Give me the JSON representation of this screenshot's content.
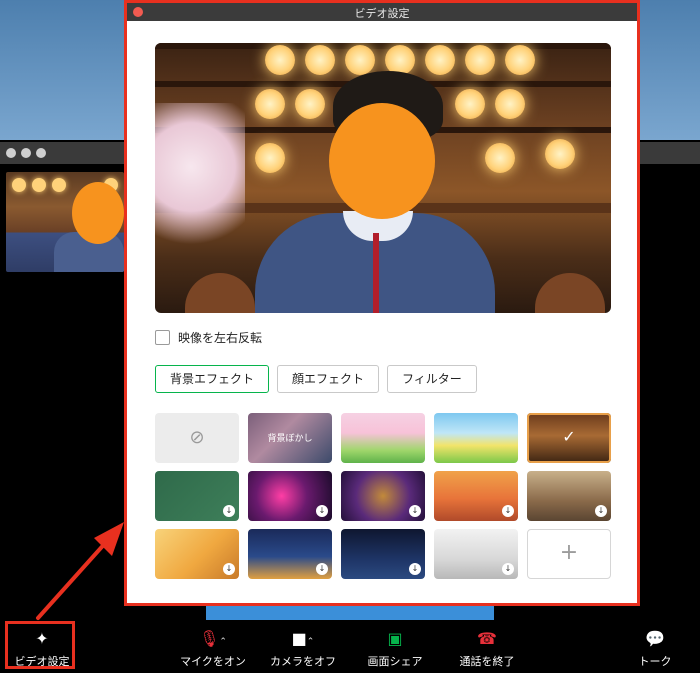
{
  "dialog": {
    "title": "ビデオ設定",
    "mirror_label": "映像を左右反転",
    "mirror_checked": false,
    "tabs": [
      {
        "label": "背景エフェクト",
        "active": true
      },
      {
        "label": "顔エフェクト",
        "active": false
      },
      {
        "label": "フィルター",
        "active": false
      }
    ],
    "effects": [
      {
        "type": "none",
        "icon": "none-icon"
      },
      {
        "type": "blur",
        "label": "背景ぼかし"
      },
      {
        "type": "bg",
        "theme": "spring-flowers"
      },
      {
        "type": "bg",
        "theme": "meadow"
      },
      {
        "type": "bg",
        "theme": "izakaya",
        "selected": true
      },
      {
        "type": "bg",
        "theme": "chalkboard",
        "download": true
      },
      {
        "type": "bg",
        "theme": "neon-glasses",
        "download": true
      },
      {
        "type": "bg",
        "theme": "party-characters",
        "download": true
      },
      {
        "type": "bg",
        "theme": "orange-room",
        "download": true
      },
      {
        "type": "bg",
        "theme": "classroom",
        "download": true
      },
      {
        "type": "bg",
        "theme": "sunny-room",
        "download": true
      },
      {
        "type": "bg",
        "theme": "night-city",
        "download": true
      },
      {
        "type": "bg",
        "theme": "starry-sky",
        "download": true
      },
      {
        "type": "bg",
        "theme": "white-office",
        "download": true
      },
      {
        "type": "add",
        "icon": "plus-icon"
      }
    ]
  },
  "toolbar": {
    "items": [
      {
        "label": "ビデオ設定",
        "icon": "sparkle-icon"
      },
      {
        "label": "マイクをオン",
        "icon": "mic-off-icon"
      },
      {
        "label": "カメラをオフ",
        "icon": "camera-icon"
      },
      {
        "label": "画面シェア",
        "icon": "screen-share-icon"
      },
      {
        "label": "通話を終了",
        "icon": "hang-up-icon"
      },
      {
        "label": "トーク",
        "icon": "chat-icon"
      }
    ]
  },
  "colors": {
    "highlight": "#e8301f",
    "active_tab": "#06b44c",
    "hangup": "#e8303a",
    "mic_off": "#e8303a",
    "screen_share": "#06b44c"
  }
}
